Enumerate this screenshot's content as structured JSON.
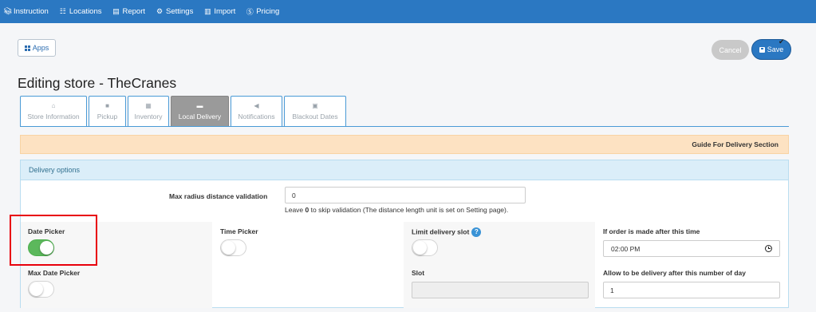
{
  "nav": {
    "items": [
      {
        "label": "Instruction",
        "icon": "book-icon"
      },
      {
        "label": "Locations",
        "icon": "sitemap-icon"
      },
      {
        "label": "Report",
        "icon": "file-icon"
      },
      {
        "label": "Settings",
        "icon": "gear-icon"
      },
      {
        "label": "Import",
        "icon": "file-import-icon"
      },
      {
        "label": "Pricing",
        "icon": "dollar-circle-icon"
      }
    ]
  },
  "toolbar": {
    "apps_label": "Apps",
    "cancel_label": "Cancel",
    "save_label": "Save"
  },
  "page": {
    "title": "Editing store - TheCranes"
  },
  "tabs": [
    {
      "label": "Store Information",
      "icon": "home-icon",
      "active": false
    },
    {
      "label": "Pickup",
      "icon": "bag-icon",
      "active": false
    },
    {
      "label": "Inventory",
      "icon": "archive-icon",
      "active": false
    },
    {
      "label": "Local Delivery",
      "icon": "truck-icon",
      "active": true
    },
    {
      "label": "Notifications",
      "icon": "bullhorn-icon",
      "active": false
    },
    {
      "label": "Blackout Dates",
      "icon": "calendar-icon",
      "active": false
    }
  ],
  "guide": {
    "label": "Guide For Delivery Section"
  },
  "delivery": {
    "section_title": "Delivery options",
    "radius_label": "Max radius distance validation",
    "radius_value": "0",
    "radius_help_prefix": "Leave ",
    "radius_help_bold": "0",
    "radius_help_suffix": " to skip validation (The distance length unit is set on Setting page).",
    "date_picker_label": "Date Picker",
    "date_picker_on": true,
    "max_date_picker_label": "Max Date Picker",
    "max_date_picker_on": false,
    "time_picker_label": "Time Picker",
    "time_picker_on": false,
    "limit_slot_label": "Limit delivery slot",
    "limit_slot_help": "?",
    "limit_slot_on": false,
    "slot_label": "Slot",
    "slot_value": "",
    "after_time_label": "If order is made after this time",
    "after_time_value": "02:00 PM",
    "days_label": "Allow to be delivery after this number of day",
    "days_value": "1"
  },
  "colors": {
    "nav_bg": "#2b78c2",
    "toggle_on": "#5cb85c",
    "guide_bg": "#fde2c2",
    "panel_head_bg": "#dbeef9",
    "highlight": "#e8000b"
  }
}
